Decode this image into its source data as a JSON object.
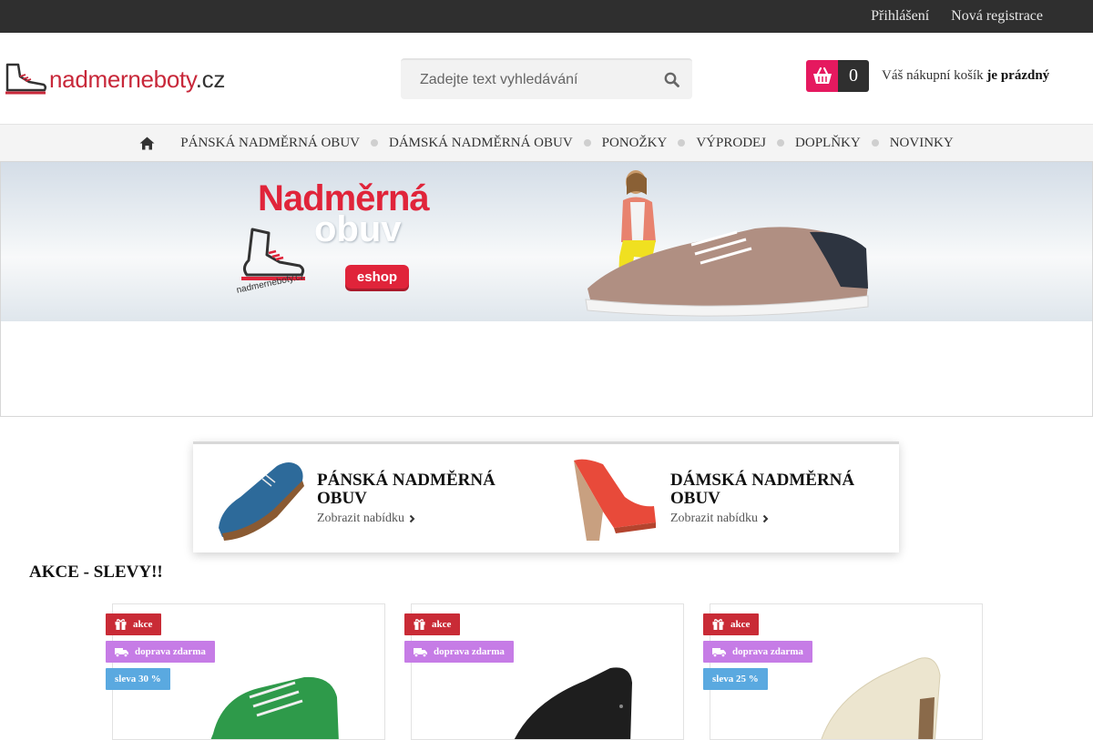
{
  "topbar": {
    "login": "Přihlášení",
    "register": "Nová registrace"
  },
  "logo": {
    "part1": "nadmerneboty",
    "part2": ".cz"
  },
  "search": {
    "placeholder": "Zadejte text vyhledávání"
  },
  "cart": {
    "count": "0",
    "text_prefix": "Váš nákupní košík",
    "text_status": "je prázdný"
  },
  "nav": {
    "items": [
      "PÁNSKÁ NADMĚRNÁ OBUV",
      "DÁMSKÁ NADMĚRNÁ OBUV",
      "PONOŽKY",
      "VÝPRODEJ",
      "DOPLŇKY",
      "NOVINKY"
    ]
  },
  "banner": {
    "title_line1": "Nadměrná",
    "title_line2": "obuv",
    "button": "eshop",
    "brand": "nadmerneboty.cz"
  },
  "categories": [
    {
      "title": "PÁNSKÁ NADMĚRNÁ OBUV",
      "link": "Zobrazit nabídku"
    },
    {
      "title": "DÁMSKÁ NADMĚRNÁ OBUV",
      "link": "Zobrazit nabídku"
    }
  ],
  "section": {
    "title": "AKCE - SLEVY!!"
  },
  "products": [
    {
      "badge_akce": "akce",
      "badge_doprava": "doprava zdarma",
      "badge_sleva": "sleva 30 %"
    },
    {
      "badge_akce": "akce",
      "badge_doprava": "doprava zdarma"
    },
    {
      "badge_akce": "akce",
      "badge_doprava": "doprava zdarma",
      "badge_sleva": "sleva 25 %"
    }
  ],
  "colors": {
    "accent_pink": "#e5195f",
    "badge_red": "#c92b36",
    "badge_purple": "#c67ce6",
    "badge_blue": "#5aa9e0",
    "topbar": "#2f2f2f"
  }
}
